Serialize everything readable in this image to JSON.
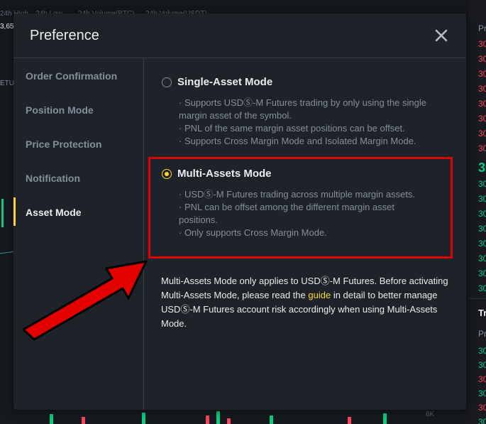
{
  "background": {
    "top_bar": [
      "24h High",
      "24h Low",
      "24h Volume(BTC)",
      "24h Volume(USDT)"
    ],
    "left_value": "3,65",
    "left_label": "ETU",
    "volume_axis": "6K"
  },
  "orderbook": {
    "header": "Pr",
    "ask_prices": [
      "30",
      "30",
      "30",
      "30",
      "30",
      "30",
      "30",
      "30"
    ],
    "mid_price": "30",
    "bid_prices": [
      "30",
      "30",
      "30",
      "30",
      "30",
      "30",
      "30",
      "30"
    ],
    "trades_title": "Tr",
    "trades_header": "Pr",
    "trade_prices": [
      "30",
      "30",
      "30",
      "30",
      "30",
      "30"
    ]
  },
  "modal": {
    "title": "Preference",
    "sidebar": [
      {
        "label": "Order Confirmation"
      },
      {
        "label": "Position Mode"
      },
      {
        "label": "Price Protection"
      },
      {
        "label": "Notification"
      },
      {
        "label": "Asset Mode"
      }
    ],
    "active_index": 4,
    "single_mode": {
      "title": "Single-Asset Mode",
      "selected": false,
      "bullets": [
        "· Supports USDⓈ-M Futures trading by only using the single",
        "margin asset of the symbol.",
        "· PNL of the same margin asset positions can be offset.",
        "· Supports Cross Margin Mode and Isolated Margin Mode."
      ]
    },
    "multi_mode": {
      "title": "Multi-Assets Mode",
      "selected": true,
      "bullets": [
        "· USDⓈ-M Futures trading across multiple margin assets.",
        "· PNL can be offset among the different margin asset",
        "positions.",
        "· Only supports Cross Margin Mode."
      ]
    },
    "note": {
      "before": "Multi-Assets Mode only applies to USDⓈ-M Futures. Before activating Multi-Assets Mode, please read the ",
      "link": "guide",
      "after": " in detail to better manage USDⓈ-M Futures account risk accordingly when using Multi-Assets Mode."
    }
  },
  "colors": {
    "accent": "#fcd535",
    "annotation": "#e00000",
    "positive": "#0ecb81",
    "negative": "#f6465d"
  },
  "icons": {
    "close": "close-icon",
    "annotation": "arrow-icon"
  }
}
